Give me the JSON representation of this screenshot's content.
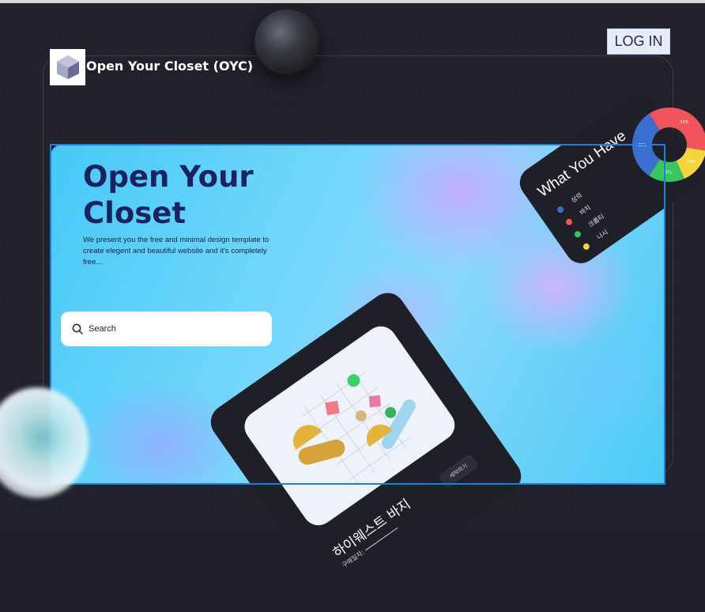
{
  "brand": {
    "name": "Open Your Closet (OYC)",
    "logo_icon": "cube-logo-icon"
  },
  "header": {
    "login_label": "LOG IN"
  },
  "hero": {
    "title": "Open Your Closet",
    "description": "We present you the free and minimal design template to create elegent and beautiful website and it's completely free...",
    "search_placeholder": "Search"
  },
  "product_card": {
    "name": "하이웨스트 바지",
    "date_label": "구매일자:",
    "button_label": "세탁하기"
  },
  "closet_card": {
    "title": "What You Have",
    "items": [
      {
        "label": "상의",
        "color": "#3a6ecf"
      },
      {
        "label": "바지",
        "color": "#f2545b"
      },
      {
        "label": "크롭티",
        "color": "#36c75e"
      },
      {
        "label": "나시",
        "color": "#f4d63c"
      }
    ]
  },
  "chart_data": {
    "type": "pie",
    "categories": [
      "상의",
      "바지",
      "크롭티",
      "나시"
    ],
    "values": [
      30,
      35,
      15,
      15
    ],
    "value_labels": [
      "30%",
      "35%",
      "15%",
      "15%"
    ],
    "colors": [
      "#3a6ecf",
      "#f2545b",
      "#36c75e",
      "#f4d63c"
    ]
  }
}
